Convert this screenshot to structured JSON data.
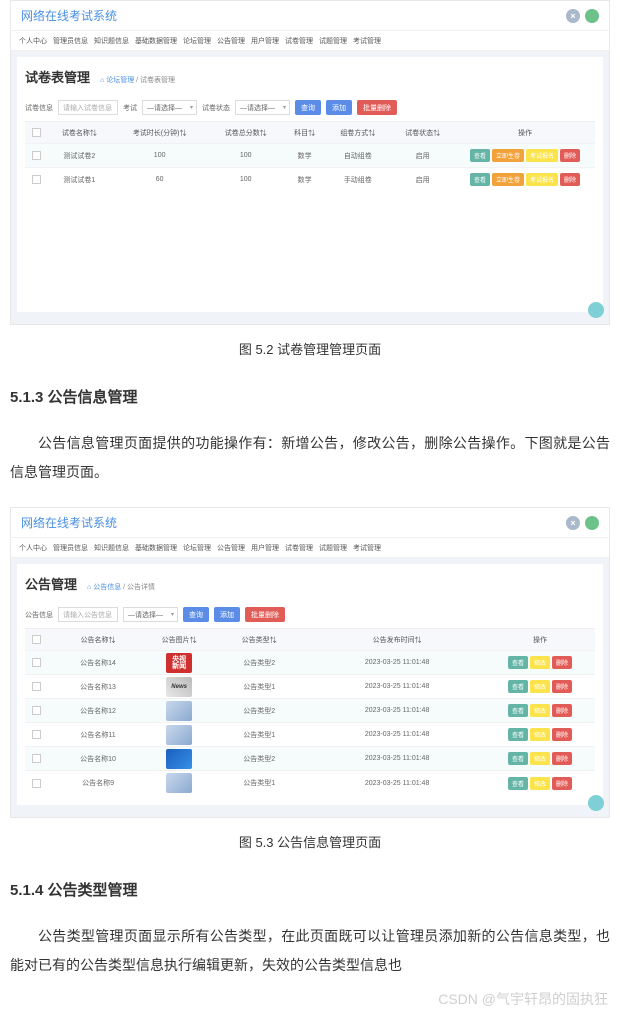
{
  "ss1": {
    "header_title": "网络在线考试系统",
    "nav": [
      "个人中心",
      "管理员信息",
      "知识题信息",
      "基础数据管理",
      "论坛管理",
      "公告管理",
      "用户管理",
      "试卷管理",
      "试题管理",
      "考试管理"
    ],
    "page_title": "试卷表管理",
    "crumb_home": "⌂ 论坛管理",
    "crumb_current": "试卷表管理",
    "search_label": "试卷信息",
    "search_placeholder": "请输入试卷信息",
    "sel1_label": "考试",
    "sel1_value": "—请选择—",
    "sel2_label": "试卷状态",
    "sel2_value": "—请选择—",
    "btn_search": "查询",
    "btn_add": "添加",
    "btn_batch_del": "批量删除",
    "cols": [
      "",
      "试卷名称⇅",
      "考试时长(分钟)⇅",
      "试卷总分数⇅",
      "科目⇅",
      "组卷方式⇅",
      "试卷状态⇅",
      "操作"
    ],
    "rows": [
      {
        "name": "测试试卷2",
        "dur": "100",
        "score": "100",
        "subj": "数学",
        "mode": "自动组卷",
        "status": "启用"
      },
      {
        "name": "测试试卷1",
        "dur": "60",
        "score": "100",
        "subj": "数学",
        "mode": "手动组卷",
        "status": "启用"
      }
    ],
    "op_view": "查看",
    "op_gen": "立即生卷",
    "op_api": "考试报名",
    "op_del": "删除"
  },
  "caption1": "图 5.2   试卷管理管理页面",
  "heading1": "5.1.3  公告信息管理",
  "para1": "公告信息管理页面提供的功能操作有：新增公告，修改公告，删除公告操作。下图就是公告信息管理页面。",
  "ss2": {
    "header_title": "网络在线考试系统",
    "nav": [
      "个人中心",
      "管理员信息",
      "知识题信息",
      "基础数据管理",
      "论坛管理",
      "公告管理",
      "用户管理",
      "试卷管理",
      "试题管理",
      "考试管理"
    ],
    "page_title": "公告管理",
    "crumb_home": "⌂ 公告信息",
    "crumb_current": "公告详情",
    "search_label": "公告信息",
    "search_placeholder": "请输入公告信息",
    "sel1_label": "",
    "sel1_value": "—请选择—",
    "btn_search": "查询",
    "btn_add": "添加",
    "btn_batch_del": "批量删除",
    "cols": [
      "",
      "公告名称⇅",
      "公告图片⇅",
      "公告类型⇅",
      "公告发布时间⇅",
      "操作"
    ],
    "rows": [
      {
        "name": "公告名称14",
        "type": "公告类型2",
        "time": "2023-03-25 11:01:48",
        "thumb": "t1"
      },
      {
        "name": "公告名称13",
        "type": "公告类型1",
        "time": "2023-03-25 11:01:48",
        "thumb": "t2"
      },
      {
        "name": "公告名称12",
        "type": "公告类型2",
        "time": "2023-03-25 11:01:48",
        "thumb": "t3"
      },
      {
        "name": "公告名称11",
        "type": "公告类型1",
        "time": "2023-03-25 11:01:48",
        "thumb": "t4"
      },
      {
        "name": "公告名称10",
        "type": "公告类型2",
        "time": "2023-03-25 11:01:48",
        "thumb": "t5"
      },
      {
        "name": "公告名称9",
        "type": "公告类型1",
        "time": "2023-03-25 11:01:48",
        "thumb": "t6"
      }
    ],
    "op_view": "查看",
    "op_edit": "修改",
    "op_del": "删除"
  },
  "caption2": "图 5.3  公告信息管理页面",
  "heading2": "5.1.4 公告类型管理",
  "para2": "公告类型管理页面显示所有公告类型，在此页面既可以让管理员添加新的公告信息类型，也能对已有的公告类型信息执行编辑更新，失效的公告类型信息也",
  "watermark": "CSDN @气宇轩昂的固执狂"
}
